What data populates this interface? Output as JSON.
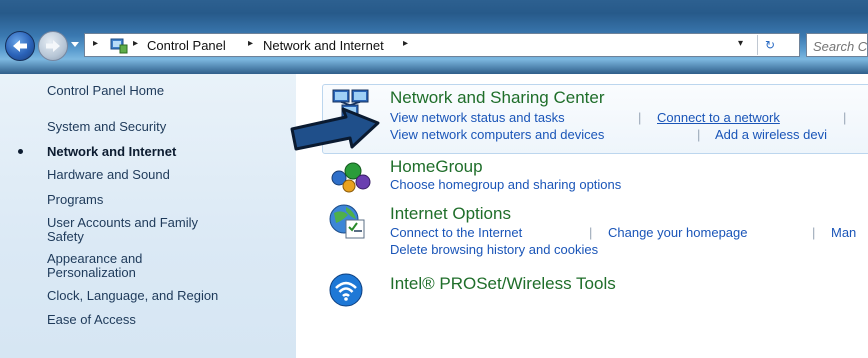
{
  "addressbar": {
    "crumbs": [
      "Control Panel",
      "Network and Internet"
    ],
    "separator": "▸",
    "dropdown_glyph": "▾",
    "refresh_glyph": "↻"
  },
  "search": {
    "placeholder": "Search Control Panel"
  },
  "sidebar": {
    "items": [
      {
        "label": "Control Panel Home"
      },
      {
        "label": "System and Security"
      },
      {
        "label": "Network and Internet",
        "active": true
      },
      {
        "label": "Hardware and Sound"
      },
      {
        "label": "Programs"
      },
      {
        "label": "User Accounts and Family",
        "label2": "Safety"
      },
      {
        "label": "Appearance and",
        "label2": "Personalization"
      },
      {
        "label": "Clock, Language, and Region"
      },
      {
        "label": "Ease of Access"
      }
    ]
  },
  "categories": {
    "network_sharing": {
      "title": "Network and Sharing Center",
      "links": [
        "View network status and tasks",
        "Connect to a network",
        "View network computers and devices",
        "Add a wireless devi"
      ],
      "icon": "network-sharing-icon"
    },
    "homegroup": {
      "title": "HomeGroup",
      "links": [
        "Choose homegroup and sharing options"
      ],
      "icon": "homegroup-icon"
    },
    "internet_options": {
      "title": "Internet Options",
      "links": [
        "Connect to the Internet",
        "Change your homepage",
        "Man",
        "Delete browsing history and cookies"
      ],
      "icon": "internet-options-icon"
    },
    "intel_wireless": {
      "title": "Intel® PROSet/Wireless Tools",
      "icon": "wireless-icon"
    }
  },
  "pipe": "|",
  "colors": {
    "category_title": "#1f6e2a",
    "link": "#1a55b8",
    "sidebar_bg": "#dbe9f5",
    "arrow_fill": "#1f4f8a"
  }
}
